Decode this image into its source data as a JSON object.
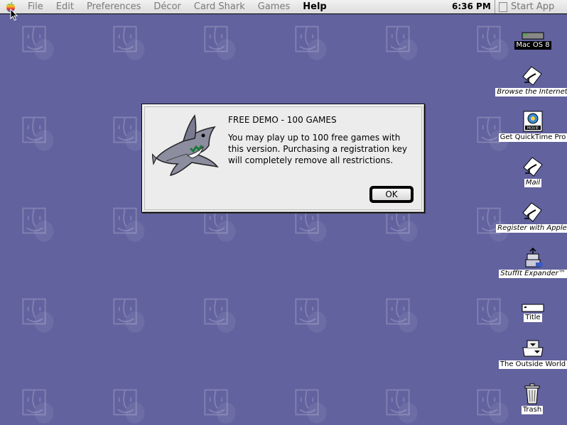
{
  "menubar": {
    "menus": [
      "File",
      "Edit",
      "Preferences",
      "Décor",
      "Card Shark",
      "Games",
      "Help"
    ],
    "active_menu": "Help",
    "clock": "6:36 PM",
    "app_switcher_label": "Start App"
  },
  "dialog": {
    "title": "FREE DEMO - 100 GAMES",
    "message": "You may play up to 100 free games with this version. Purchasing a registration key will completely remove all restrictions.",
    "ok_label": "OK"
  },
  "desktop_icons": [
    {
      "label": "Mac OS 8",
      "icon": "hard-disk-icon"
    },
    {
      "label": "Browse the Internet",
      "icon": "alias-document-icon"
    },
    {
      "label": "Get QuickTime Pro",
      "icon": "quicktime-movie-icon"
    },
    {
      "label": "Mail",
      "icon": "alias-document-icon"
    },
    {
      "label": "Register with Apple",
      "icon": "alias-document-icon"
    },
    {
      "label": "StuffIt Expander™",
      "icon": "stuffit-expander-icon"
    },
    {
      "label": "Title",
      "icon": "blank-document-icon"
    },
    {
      "label": "The Outside World",
      "icon": "network-icon"
    },
    {
      "label": "Trash",
      "icon": "trash-icon"
    }
  ],
  "colors": {
    "desktop": "#62629f",
    "menubar": "#e6e6e6",
    "dialog": "#ececec"
  }
}
